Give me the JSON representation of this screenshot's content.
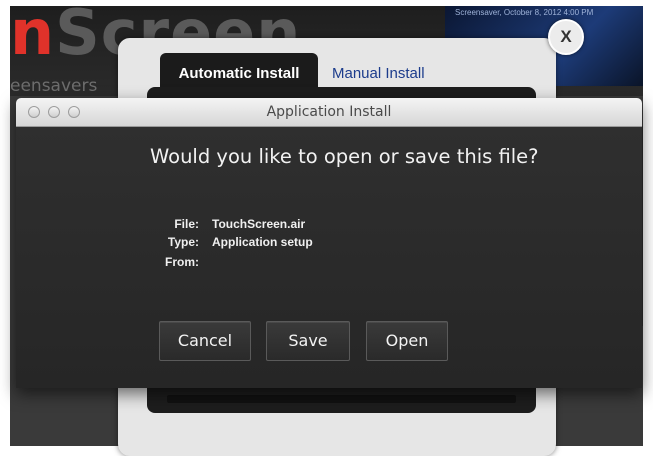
{
  "background_site": {
    "logo_part1": "n",
    "logo_part2": "Screen",
    "tagline": "eensavers",
    "thumb_text": "Screensaver, October 8, 2012 4:00 PM"
  },
  "installer": {
    "tabs": [
      {
        "label": "Automatic Install",
        "active": true
      },
      {
        "label": "Manual Install",
        "active": false
      }
    ],
    "close_label": "X"
  },
  "dialog": {
    "title": "Application Install",
    "question": "Would you like to open or save this file?",
    "fields": {
      "file_label": "File:",
      "file_value": "TouchScreen.air",
      "type_label": "Type:",
      "type_value": "Application setup",
      "from_label": "From:",
      "from_value": ""
    },
    "buttons": {
      "cancel": "Cancel",
      "save": "Save",
      "open": "Open"
    }
  },
  "colors": {
    "dialog_bg": "#2a2a2a",
    "tab_link": "#1c3c8c",
    "logo_red": "#e0322a"
  }
}
